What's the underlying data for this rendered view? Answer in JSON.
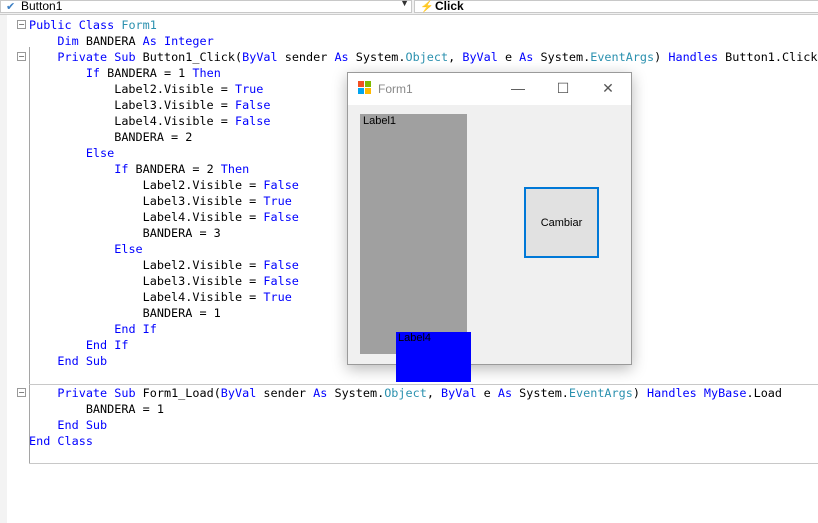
{
  "toolbar": {
    "object_combo": "Button1",
    "event_combo": "Click"
  },
  "code_lines": [
    [
      {
        "t": "Public Class ",
        "c": "k"
      },
      {
        "t": "Form1",
        "c": "t"
      }
    ],
    [
      {
        "t": "    "
      },
      {
        "t": "Dim",
        "c": "k"
      },
      {
        "t": " BANDERA "
      },
      {
        "t": "As Integer",
        "c": "k"
      }
    ],
    [
      {
        "t": "    "
      },
      {
        "t": "Private Sub",
        "c": "k"
      },
      {
        "t": " Button1_Click("
      },
      {
        "t": "ByVal",
        "c": "k"
      },
      {
        "t": " sender "
      },
      {
        "t": "As",
        "c": "k"
      },
      {
        "t": " System."
      },
      {
        "t": "Object",
        "c": "t"
      },
      {
        "t": ", "
      },
      {
        "t": "ByVal",
        "c": "k"
      },
      {
        "t": " e "
      },
      {
        "t": "As",
        "c": "k"
      },
      {
        "t": " System."
      },
      {
        "t": "EventArgs",
        "c": "t"
      },
      {
        "t": ") "
      },
      {
        "t": "Handles",
        "c": "k"
      },
      {
        "t": " Button1.Click"
      }
    ],
    [
      {
        "t": "        "
      },
      {
        "t": "If",
        "c": "k"
      },
      {
        "t": " BANDERA = 1 "
      },
      {
        "t": "Then",
        "c": "k"
      }
    ],
    [
      {
        "t": "            Label2.Visible = "
      },
      {
        "t": "True",
        "c": "k"
      }
    ],
    [
      {
        "t": "            Label3.Visible = "
      },
      {
        "t": "False",
        "c": "k"
      }
    ],
    [
      {
        "t": "            Label4.Visible = "
      },
      {
        "t": "False",
        "c": "k"
      }
    ],
    [
      {
        "t": "            BANDERA = 2"
      }
    ],
    [
      {
        "t": "        "
      },
      {
        "t": "Else",
        "c": "k"
      }
    ],
    [
      {
        "t": "            "
      },
      {
        "t": "If",
        "c": "k"
      },
      {
        "t": " BANDERA = 2 "
      },
      {
        "t": "Then",
        "c": "k"
      }
    ],
    [
      {
        "t": "                Label2.Visible = "
      },
      {
        "t": "False",
        "c": "k"
      }
    ],
    [
      {
        "t": "                Label3.Visible = "
      },
      {
        "t": "True",
        "c": "k"
      }
    ],
    [
      {
        "t": "                Label4.Visible = "
      },
      {
        "t": "False",
        "c": "k"
      }
    ],
    [
      {
        "t": "                BANDERA = 3"
      }
    ],
    [
      {
        "t": "            "
      },
      {
        "t": "Else",
        "c": "k"
      }
    ],
    [
      {
        "t": "                Label2.Visible = "
      },
      {
        "t": "False",
        "c": "k"
      }
    ],
    [
      {
        "t": "                Label3.Visible = "
      },
      {
        "t": "False",
        "c": "k"
      }
    ],
    [
      {
        "t": "                Label4.Visible = "
      },
      {
        "t": "True",
        "c": "k"
      }
    ],
    [
      {
        "t": "                BANDERA = 1"
      }
    ],
    [
      {
        "t": "            "
      },
      {
        "t": "End If",
        "c": "k"
      }
    ],
    [
      {
        "t": "        "
      },
      {
        "t": "End If",
        "c": "k"
      }
    ],
    [
      {
        "t": "    "
      },
      {
        "t": "End Sub",
        "c": "k"
      }
    ],
    [],
    [
      {
        "t": "    "
      },
      {
        "t": "Private Sub",
        "c": "k"
      },
      {
        "t": " Form1_Load("
      },
      {
        "t": "ByVal",
        "c": "k"
      },
      {
        "t": " sender "
      },
      {
        "t": "As",
        "c": "k"
      },
      {
        "t": " System."
      },
      {
        "t": "Object",
        "c": "t"
      },
      {
        "t": ", "
      },
      {
        "t": "ByVal",
        "c": "k"
      },
      {
        "t": " e "
      },
      {
        "t": "As",
        "c": "k"
      },
      {
        "t": " System."
      },
      {
        "t": "EventArgs",
        "c": "t"
      },
      {
        "t": ") "
      },
      {
        "t": "Handles",
        "c": "k"
      },
      {
        "t": " "
      },
      {
        "t": "MyBase",
        "c": "k"
      },
      {
        "t": ".Load"
      }
    ],
    [
      {
        "t": "        BANDERA = 1"
      }
    ],
    [
      {
        "t": "    "
      },
      {
        "t": "End Sub",
        "c": "k"
      }
    ],
    [
      {
        "t": "End Class",
        "c": "k"
      }
    ]
  ],
  "form": {
    "title": "Form1",
    "label1": "Label1",
    "label4": "Label4",
    "button": "Cambiar",
    "controls": {
      "minimize": "—",
      "maximize": "☐",
      "close": "✕"
    }
  },
  "colors": {
    "keyword": "#0000ff",
    "type": "#2b91af",
    "label1_bg": "#a0a0a0",
    "label4_bg": "#0000ff",
    "button_border": "#0078d7"
  }
}
